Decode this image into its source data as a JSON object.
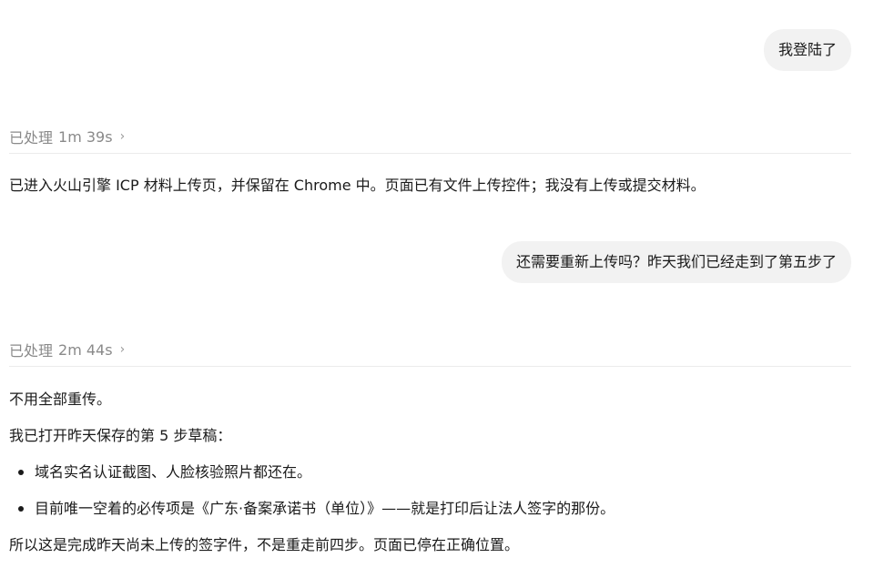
{
  "messages": {
    "user_1": "我登陆了",
    "processed_1": {
      "label": "已处理",
      "duration": "1m 39s",
      "chevron": "›"
    },
    "assistant_1": "已进入火山引擎 ICP 材料上传页，并保留在 Chrome 中。页面已有文件上传控件；我没有上传或提交材料。",
    "user_2": "还需要重新上传吗？昨天我们已经走到了第五步了",
    "processed_2": {
      "label": "已处理",
      "duration": "2m 44s",
      "chevron": "›"
    },
    "assistant_2": {
      "line_1": "不用全部重传。",
      "line_2": "我已打开昨天保存的第 5 步草稿：",
      "bullets": [
        "域名实名认证截图、人脸核验照片都还在。",
        "目前唯一空着的必传项是《广东·备案承诺书（单位）》——就是打印后让法人签字的那份。"
      ],
      "line_3": "所以这是完成昨天尚未上传的签字件，不是重走前四步。页面已停在正确位置。"
    }
  },
  "icons": {
    "expand": "chevron-right-icon"
  }
}
